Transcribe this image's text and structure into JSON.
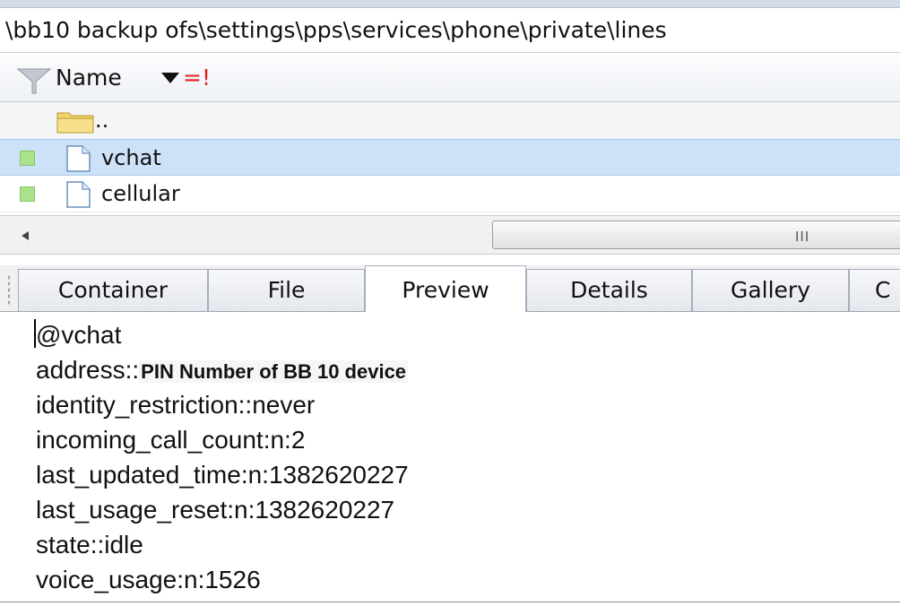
{
  "path": "\\bb10 backup ofs\\settings\\pps\\services\\phone\\private\\lines",
  "list": {
    "header": {
      "name_label": "Name",
      "filter_flag": "=!"
    },
    "parent_label": "..",
    "rows": [
      {
        "label": "vchat",
        "selected": true
      },
      {
        "label": "cellular",
        "selected": false
      }
    ],
    "scrollbar_grip": "III"
  },
  "tabs": [
    {
      "label": "Container",
      "active": false
    },
    {
      "label": "File",
      "active": false
    },
    {
      "label": "Preview",
      "active": true
    },
    {
      "label": "Details",
      "active": false
    },
    {
      "label": "Gallery",
      "active": false
    },
    {
      "label": "C",
      "active": false
    }
  ],
  "preview": {
    "line1": "@vchat",
    "address_key": "address::",
    "address_value": "PIN Number of BB 10 device",
    "lines": [
      "identity_restriction::never",
      "incoming_call_count:n:2",
      "last_updated_time:n:1382620227",
      "last_usage_reset:n:1382620227",
      "state::idle",
      "voice_usage:n:1526"
    ]
  },
  "colors": {
    "selection": "#cde2f8",
    "status_green": "#a9e289",
    "filter_flag": "#e02020"
  }
}
